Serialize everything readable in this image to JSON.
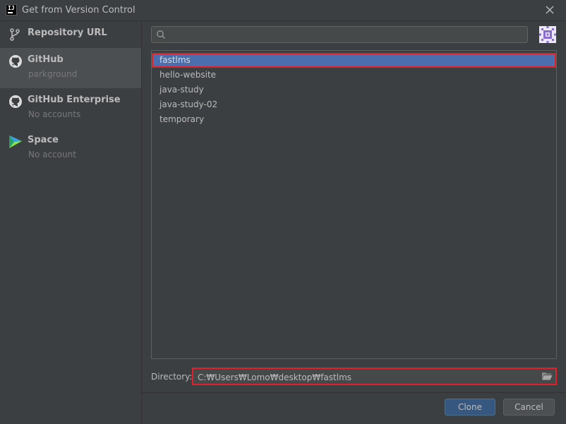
{
  "window": {
    "title": "Get from Version Control"
  },
  "sidebar": {
    "items": [
      {
        "label": "Repository URL",
        "sub": "",
        "icon": "git-branch-icon"
      },
      {
        "label": "GitHub",
        "sub": "parkground",
        "icon": "github-icon"
      },
      {
        "label": "GitHub Enterprise",
        "sub": "No accounts",
        "icon": "github-icon"
      },
      {
        "label": "Space",
        "sub": "No account",
        "icon": "space-icon"
      }
    ],
    "selected": "GitHub"
  },
  "search": {
    "value": "",
    "placeholder": ""
  },
  "repositories": {
    "items": [
      "fastlms",
      "hello-website",
      "java-study",
      "java-study-02",
      "temporary"
    ],
    "selected": "fastlms"
  },
  "directory": {
    "label": "Directory:",
    "value": "C:₩Users₩Lomo₩desktop₩fastlms"
  },
  "buttons": {
    "clone": "Clone",
    "cancel": "Cancel"
  },
  "colors": {
    "background": "#3c3f41",
    "selection": "#4b6eaf",
    "highlight_border": "#e0202a",
    "primary_button": "#365880"
  }
}
